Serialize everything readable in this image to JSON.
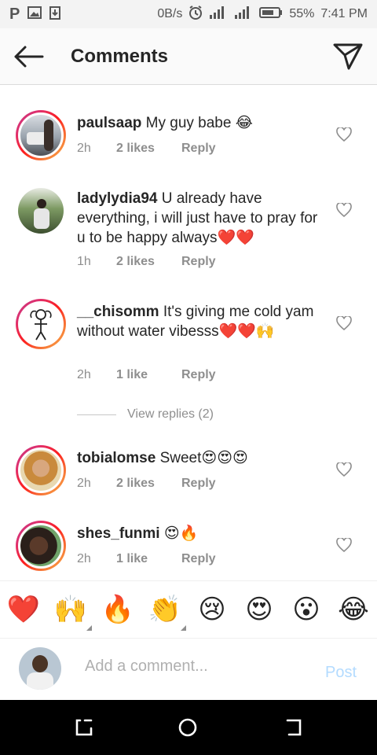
{
  "status_bar": {
    "network_speed": "0B/s",
    "battery": "55%",
    "time": "7:41 PM"
  },
  "header": {
    "title": "Comments"
  },
  "comments": [
    {
      "username": "paulsaap",
      "text": "My guy babe 😂",
      "time": "2h",
      "likes": "2 likes",
      "reply": "Reply"
    },
    {
      "username": "ladylydia94",
      "text": "U already have everything, i will just have to pray for u to be happy always❤️❤️",
      "time": "1h",
      "likes": "2 likes",
      "reply": "Reply"
    },
    {
      "username": "__chisomm",
      "text": "It's giving me cold yam without water vibesss❤️❤️🙌",
      "time": "2h",
      "likes": "1 like",
      "reply": "Reply"
    },
    {
      "username": "tobialomse",
      "text": "Sweet😍😍😍",
      "time": "2h",
      "likes": "2 likes",
      "reply": "Reply"
    },
    {
      "username": "shes_funmi",
      "text": "😍🔥",
      "time": "2h",
      "likes": "1 like",
      "reply": "Reply"
    }
  ],
  "view_replies": "View replies (2)",
  "emoji_bar": [
    "❤️",
    "🙌",
    "🔥",
    "👏",
    "😢",
    "😍",
    "😮",
    "😂"
  ],
  "add_comment": {
    "placeholder": "Add a comment...",
    "post_label": "Post"
  },
  "colors": {
    "accent_disabled": "#b3dbff",
    "muted_text": "#8e8e8e",
    "story_ring": "#e1306c"
  }
}
